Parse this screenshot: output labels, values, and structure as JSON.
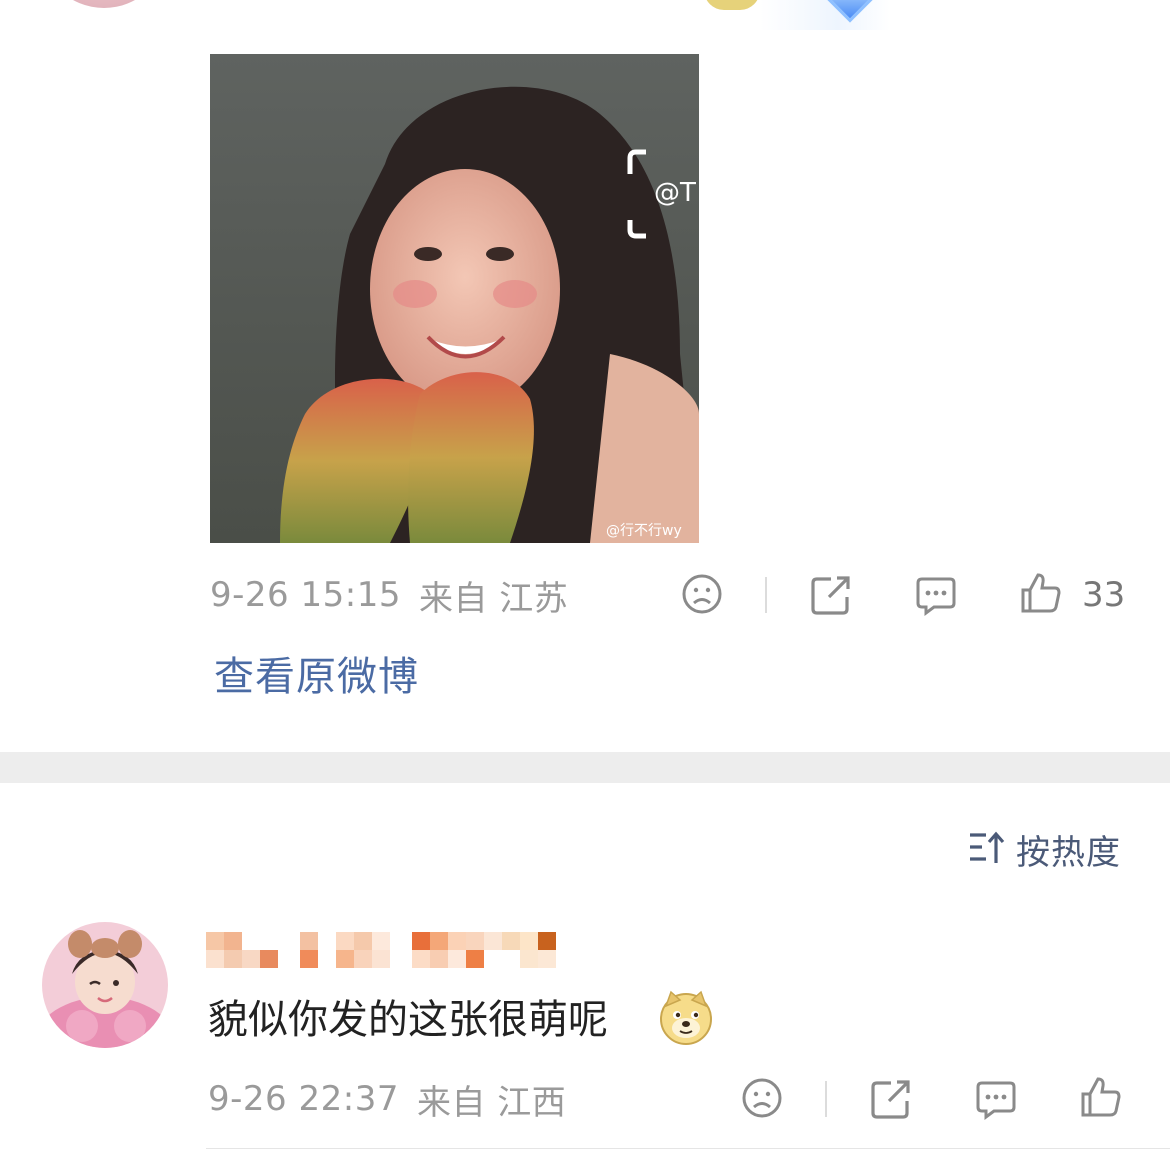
{
  "post": {
    "top_text_cut": "",
    "image": {
      "crop_text": "@T",
      "watermark": "@行不行wy"
    },
    "meta": {
      "datetime": "9-26 15:15",
      "location": "来自 江苏",
      "like_count": "33"
    },
    "view_original_label": "查看原微博"
  },
  "sort": {
    "label": "按热度",
    "icon": "sort-icon"
  },
  "comment": {
    "text": "貌似你发的这张很萌呢",
    "emoji": "doge-emoji",
    "meta": {
      "datetime": "9-26 22:37",
      "location": "来自 江西"
    }
  },
  "colors": {
    "link": "#4b6ba4",
    "meta_gray": "#9a9a9a",
    "icon_gray": "#8a8a8a",
    "band": "#ededed",
    "sort_text": "#4b5a78"
  }
}
